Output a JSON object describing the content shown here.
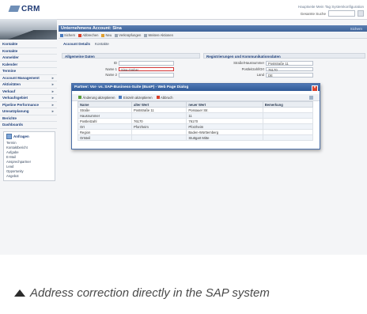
{
  "app": {
    "logo_text": "CRM"
  },
  "header": {
    "links": "Hauptseite  Mein Tag  Systemkonfiguration",
    "search_label": "Gesamte Suche",
    "search_placeholder": ""
  },
  "sidebar": {
    "items": [
      {
        "label": "Kontakte",
        "arrow": ""
      },
      {
        "label": "Kontakte",
        "arrow": ""
      },
      {
        "label": "Anmelder",
        "arrow": ""
      },
      {
        "label": "Kalender",
        "arrow": ""
      },
      {
        "label": "Termine",
        "arrow": ""
      },
      {
        "label": "Account Management",
        "arrow": "▸"
      },
      {
        "label": "Aktivitäten",
        "arrow": "▸"
      },
      {
        "label": "Verkauf",
        "arrow": "▸"
      },
      {
        "label": "Verkaufsgebiet",
        "arrow": "▸"
      },
      {
        "label": "Pipeline Performance",
        "arrow": "▸"
      },
      {
        "label": "Umsatzplanung",
        "arrow": "▸"
      },
      {
        "label": "Berichte",
        "arrow": ""
      },
      {
        "label": "Dashboards",
        "arrow": ""
      }
    ],
    "panel": {
      "title": "Anfragen",
      "items": [
        "Termin",
        "Kontaktbericht",
        "Aufgabe",
        "E-Mail",
        "Ansprechpartner",
        "Lead",
        "Opportunity",
        "Angebot"
      ]
    }
  },
  "main": {
    "title": "Unternehmens Account: Sina",
    "title_right": "Sichern",
    "toolbar": [
      "Sichern",
      "Abbrechen",
      "Neu",
      "Verknüpfungen",
      "Weitere Aktionen"
    ],
    "tabs": [
      "Account Details",
      "Kontakte"
    ],
    "left_section": "Allgemeine Daten",
    "right_section": "Registrierungen und Kommunikationsdaten",
    "fields_left": [
      {
        "label": "ID",
        "value": ""
      },
      {
        "label": "Name 1",
        "value": "Sina GmbH",
        "required": true
      },
      {
        "label": "Name 2",
        "value": ""
      }
    ],
    "fields_right": [
      {
        "label": "Straße/Hausnummer",
        "value": "Poststraße 11"
      },
      {
        "label": "Postleitzahl/Ort",
        "value": "76170"
      },
      {
        "label": "Land",
        "value": "DE"
      }
    ]
  },
  "dialog": {
    "title": "Partner: Vor- vs. SAP-Business-Suite (BusP) - Web Page Dialog",
    "toolbar": [
      "Änderung akzeptieren",
      "Einzeln akzeptieren",
      "Abbruch"
    ],
    "columns": [
      "Name",
      "alter Wert",
      "neuer Wert",
      "Bemerkung"
    ],
    "rows": [
      [
        "Straße",
        "Poststraße 11",
        "Possauer Str.",
        ""
      ],
      [
        "Hausnummer",
        "",
        "11",
        ""
      ],
      [
        "Postleitzahl",
        "76170",
        "76170",
        ""
      ],
      [
        "Ort",
        "Pforzheim",
        "Pforzheim",
        ""
      ],
      [
        "Region",
        "",
        "Baden-Württemberg",
        ""
      ],
      [
        "Ortsteil",
        "",
        "Stuttgart Mitte",
        ""
      ]
    ]
  },
  "caption": {
    "text": "Address correction directly in the SAP system"
  },
  "colors": {
    "accent": "#3e6399",
    "caption_text": "#4a4a4a"
  }
}
